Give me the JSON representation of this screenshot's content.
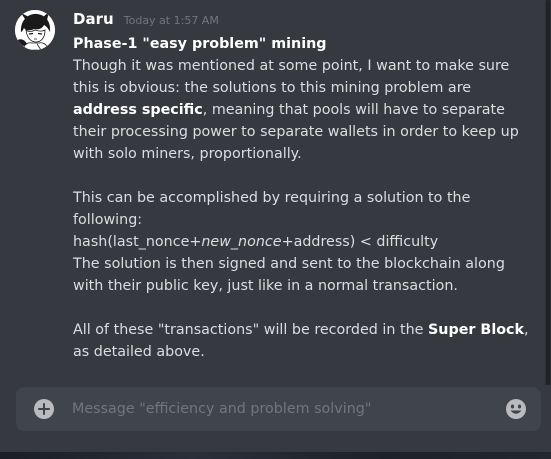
{
  "message": {
    "username": "Daru",
    "timestamp": "Today at 1:57 AM",
    "title": "Phase-1 \"easy problem\" mining",
    "p1_line1": "Though it was mentioned at some point, I want to make sure",
    "p1_line2": "this is obvious: the solutions to this mining problem are",
    "p1_bold": "address specific",
    "p1_line3_rest": ", meaning that pools will have to separate",
    "p1_line4": "their processing power to separate wallets in order to keep up",
    "p1_line5": "with solo miners, proportionally.",
    "p2_line1": "This can be accomplished by requiring a solution to the",
    "p2_line2": "following:",
    "hash_prefix": "hash(last_nonce+",
    "hash_italic": "new_nonce",
    "hash_suffix": "+address) < difficulty",
    "p2_line4": "The solution is then signed and sent to the blockchain along",
    "p2_line5": "with their public key, just like in a normal transaction.",
    "p3_prefix": "All of these \"transactions\" will be recorded in the ",
    "p3_bold": "Super Block",
    "p3_suffix": ",",
    "p3_line2": "as detailed above."
  },
  "composer": {
    "placeholder": "Message \"efficiency and problem solving\""
  },
  "icons": {
    "avatar": "anime-character-avatar",
    "add": "plus-circle-icon",
    "emoji": "smiley-emoji-icon"
  }
}
